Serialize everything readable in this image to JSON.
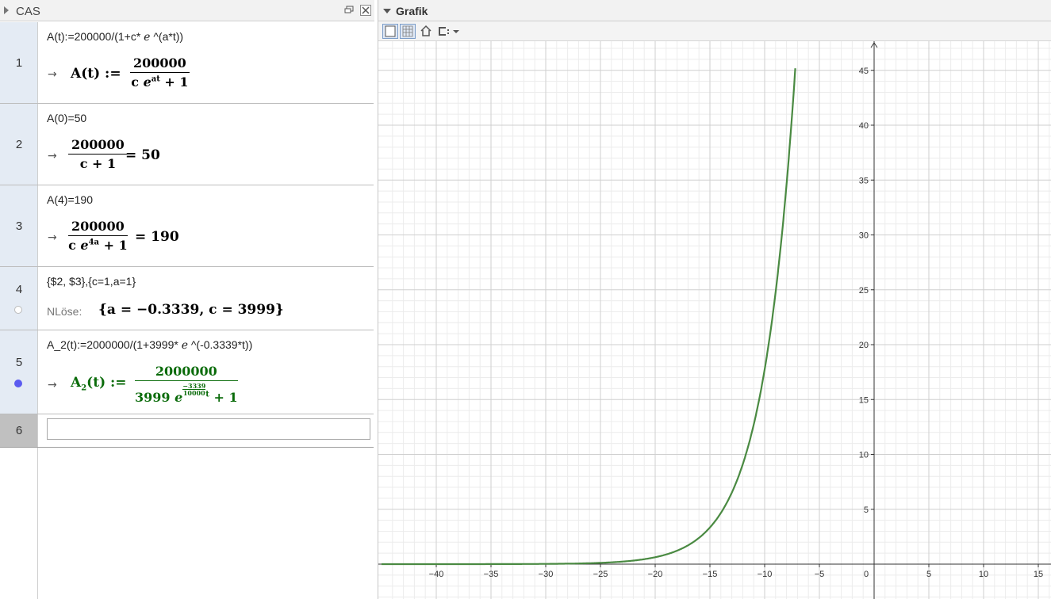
{
  "cas": {
    "title": "CAS",
    "rows": [
      {
        "num": "1",
        "input": "A(t):=200000/(1+c* ℯ ^(a*t))",
        "output": {
          "lhs": "A(t) :=",
          "num": "200000",
          "den_a": "c ",
          "den_e": "e",
          "den_exp": "at",
          "den_b": " + 1"
        }
      },
      {
        "num": "2",
        "input": "A(0)=50",
        "output": {
          "num": "200000",
          "den": "c + 1",
          "rhs": "= 50"
        }
      },
      {
        "num": "3",
        "input": "A(4)=190",
        "output": {
          "num": "200000",
          "den_a": "c ",
          "den_e": "e",
          "den_exp": "4a",
          "den_b": " + 1",
          "rhs": "= 190"
        }
      },
      {
        "num": "4",
        "input": "{$2, $3},{c=1,a=1}",
        "output": {
          "command": "NLöse:",
          "result": "{a = −0.3339, c = 3999}"
        }
      },
      {
        "num": "5",
        "input": "A_2(t):=2000000/(1+3999* ℯ ^(-0.3339*t))",
        "output": {
          "lhs_a": "A",
          "lhs_sub": "2",
          "lhs_b": "(t) :=",
          "num": "2000000",
          "den_a": "3999 ",
          "den_e": "e",
          "exp_num": "−3339",
          "exp_den": "10000",
          "exp_var": "t",
          "den_b": " + 1"
        }
      },
      {
        "num": "6",
        "input": ""
      }
    ]
  },
  "grafik": {
    "title": "Grafik",
    "toolbar": [
      "graphics-style-icon",
      "grid-icon",
      "home-icon",
      "zoom-options-icon"
    ]
  },
  "chart_data": {
    "type": "line",
    "title": "",
    "xlabel": "",
    "ylabel": "",
    "xlim": [
      -45,
      16
    ],
    "ylim": [
      -3,
      47.5
    ],
    "x_ticks": [
      -40,
      -35,
      -30,
      -25,
      -20,
      -15,
      -10,
      -5,
      0,
      5,
      10,
      15
    ],
    "y_ticks": [
      5,
      10,
      15,
      20,
      25,
      30,
      35,
      40,
      45
    ],
    "grid": true,
    "series": [
      {
        "color": "#4a8a42",
        "function": "2000000/(1+3999*exp(-0.3339*t))",
        "x": [
          -45,
          -40,
          -35,
          -30,
          -25,
          -20,
          -18,
          -16,
          -15,
          -14,
          -13,
          -12,
          -11,
          -10,
          -9,
          -8.5,
          -8,
          -7.5
        ],
        "y": [
          0.15,
          0.8,
          4.3,
          0.23,
          1.2,
          0.63,
          1.23,
          2.4,
          3.4,
          4.8,
          6.7,
          9.4,
          13.1,
          18.3,
          25.5,
          30.2,
          35.7,
          42.1
        ]
      }
    ]
  }
}
